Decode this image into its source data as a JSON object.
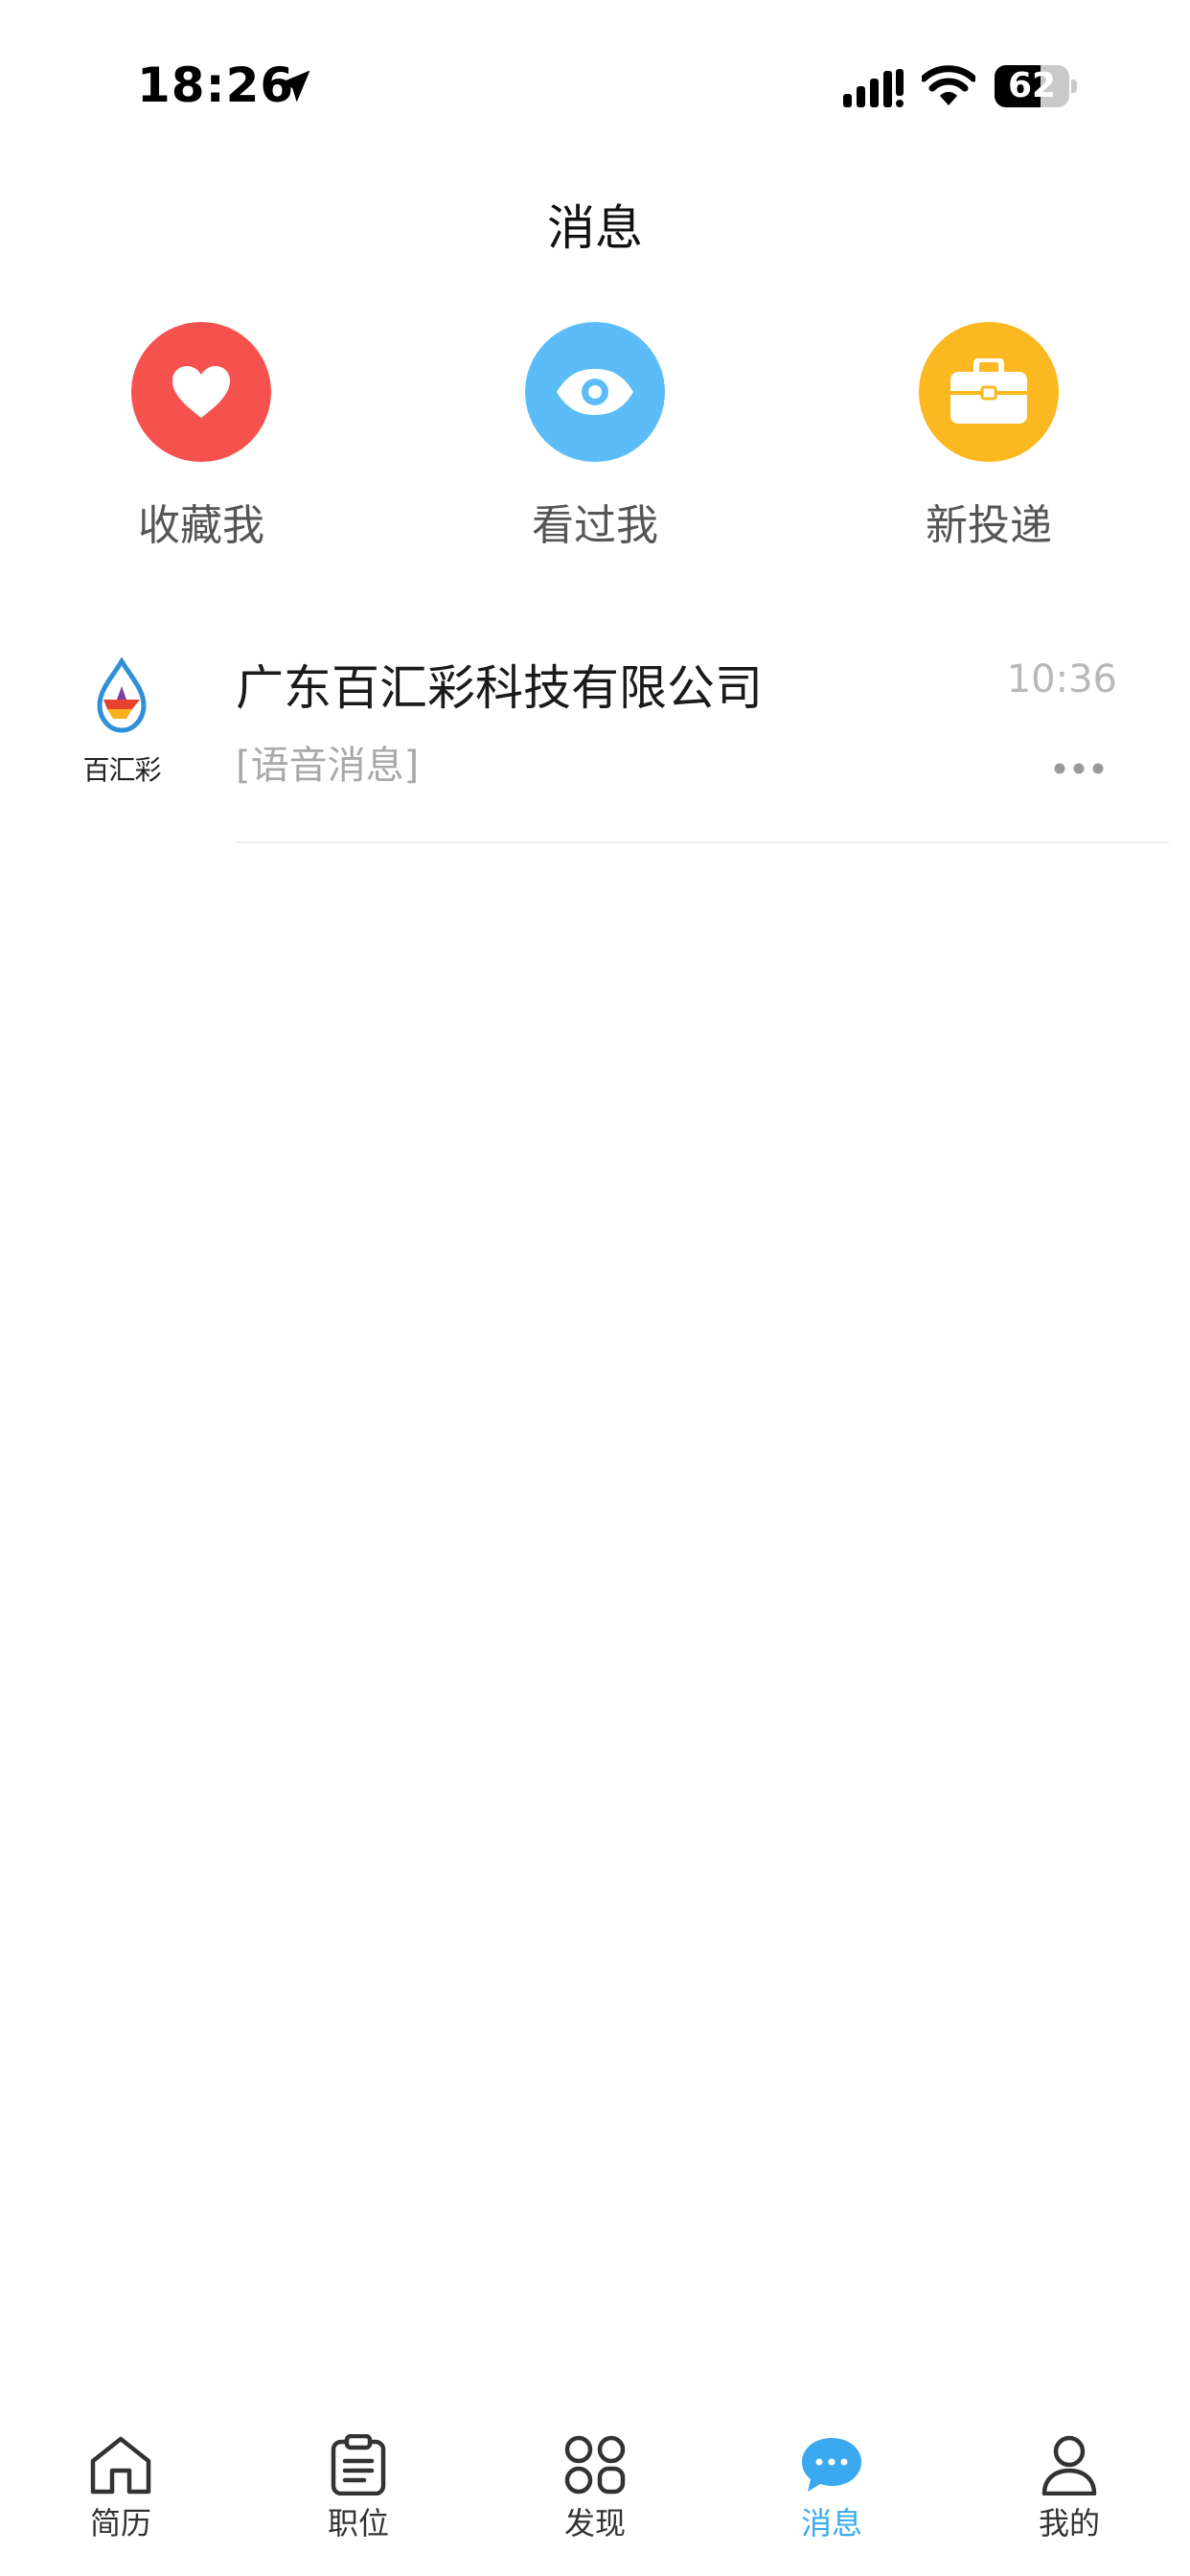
{
  "status_bar": {
    "time": "18:26",
    "battery_text": "62",
    "battery_level": 0.62
  },
  "header": {
    "title": "消息"
  },
  "quick_actions": [
    {
      "label": "收藏我",
      "icon": "heart-icon",
      "color": "#f5524f"
    },
    {
      "label": "看过我",
      "icon": "eye-icon",
      "color": "#5bbcf7"
    },
    {
      "label": "新投递",
      "icon": "briefcase-icon",
      "color": "#fbb820"
    }
  ],
  "conversations": [
    {
      "avatar_text": "百汇彩",
      "name": "广东百汇彩科技有限公司",
      "time": "10:36",
      "preview": "[语音消息]"
    }
  ],
  "tabs": [
    {
      "label": "简历",
      "icon": "house-icon",
      "active": false
    },
    {
      "label": "职位",
      "icon": "clipboard-icon",
      "active": false
    },
    {
      "label": "发现",
      "icon": "grid-circles-icon",
      "active": false
    },
    {
      "label": "消息",
      "icon": "chat-bubble-icon",
      "active": true
    },
    {
      "label": "我的",
      "icon": "person-icon",
      "active": false
    }
  ],
  "colors": {
    "accent": "#3aa9f0",
    "heart": "#f5524f",
    "eye": "#5bbcf7",
    "briefcase": "#fbb820",
    "muted_text": "#a8a8a8"
  }
}
